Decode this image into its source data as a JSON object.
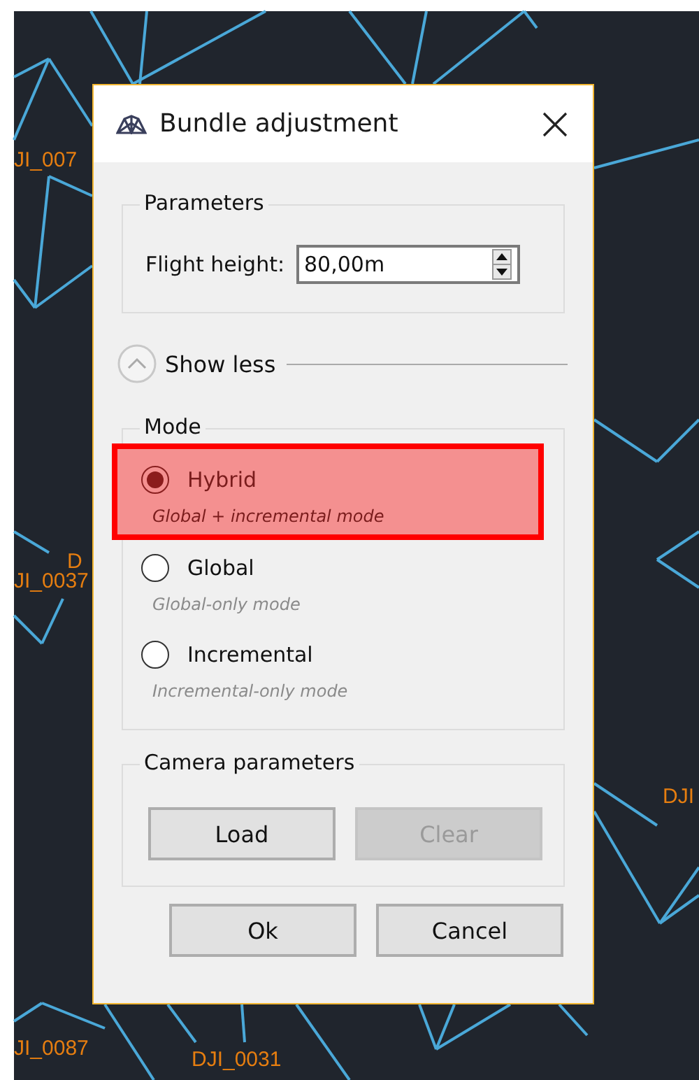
{
  "canvas": {
    "labels": [
      {
        "text": "JI_007"
      },
      {
        "text": "D"
      },
      {
        "text": "JI_0037"
      },
      {
        "text": "DJI"
      },
      {
        "text": "JI_0087"
      },
      {
        "text": "DJI_0031"
      }
    ]
  },
  "dialog": {
    "title": "Bundle adjustment",
    "parameters": {
      "title": "Parameters",
      "label": "Flight height:",
      "value": "80,00m"
    },
    "toggle": {
      "label": "Show less",
      "expanded": true
    },
    "mode": {
      "title": "Mode",
      "options": [
        {
          "label": "Hybrid",
          "description": "Global + incremental mode",
          "selected": true,
          "highlighted": true
        },
        {
          "label": "Global",
          "description": "Global-only mode",
          "selected": false,
          "highlighted": false
        },
        {
          "label": "Incremental",
          "description": "Incremental-only mode",
          "selected": false,
          "highlighted": false
        }
      ]
    },
    "camera": {
      "title": "Camera parameters",
      "buttons": [
        {
          "label": "Load",
          "disabled": false
        },
        {
          "label": "Clear",
          "disabled": true
        }
      ]
    },
    "buttons": [
      {
        "label": "Ok"
      },
      {
        "label": "Cancel"
      }
    ]
  }
}
